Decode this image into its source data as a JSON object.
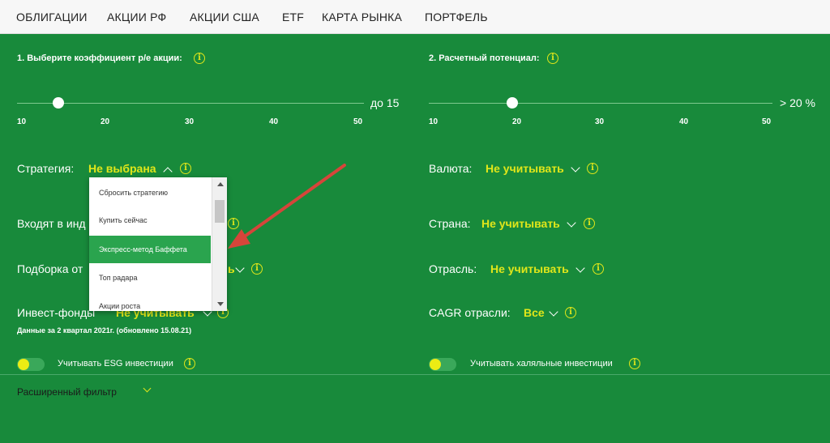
{
  "nav": {
    "items": [
      "ОБЛИГАЦИИ",
      "АКЦИИ РФ",
      "АКЦИИ США",
      "ETF",
      "КАРТА РЫНКА",
      "ПОРТФЕЛЬ"
    ]
  },
  "pe": {
    "title": "1. Выберите коэффициент p/e акции:",
    "value_label": "до 15",
    "value": 15,
    "ticks": [
      "10",
      "20",
      "30",
      "40",
      "50"
    ]
  },
  "potential": {
    "title": "2. Расчетный потенциал:",
    "value_label": "> 20 %",
    "value": 20,
    "ticks": [
      "10",
      "20",
      "30",
      "40",
      "50"
    ]
  },
  "left": {
    "strategy": {
      "label": "Стратегия:",
      "value": "Не выбрана"
    },
    "index": {
      "label": "Входят в инд"
    },
    "selection": {
      "label": "Подборка от",
      "value": "ь"
    },
    "funds": {
      "label": "Инвест-фонды",
      "value": "Не учитывать"
    },
    "note": "Данные за 2 квартал 2021г. (обновлено 15.08.21)",
    "esg": {
      "label": "Учитывать ESG инвестиции"
    }
  },
  "right": {
    "currency": {
      "label": "Валюта:",
      "value": "Не учитывать"
    },
    "country": {
      "label": "Страна:",
      "value": "Не учитывать"
    },
    "sector": {
      "label": "Отрасль:",
      "value": "Не учитывать"
    },
    "cagr": {
      "label": "CAGR отрасли:",
      "value": "Все"
    },
    "halal": {
      "label": "Учитывать халяльные инвестиции"
    }
  },
  "dropdown": {
    "items": [
      "Сбросить стратегию",
      "Купить сейчас",
      "Экспресс-метод Баффета",
      "Топ радара",
      "Акции роста"
    ],
    "active": "Экспресс-метод Баффета"
  },
  "advanced": {
    "label": "Расширенный фильтр"
  },
  "info_symbol": "i",
  "colors": {
    "green": "#188a3b",
    "accent": "#e0e61a",
    "highlight": "#2aa44e",
    "arrow": "#d6453a"
  }
}
